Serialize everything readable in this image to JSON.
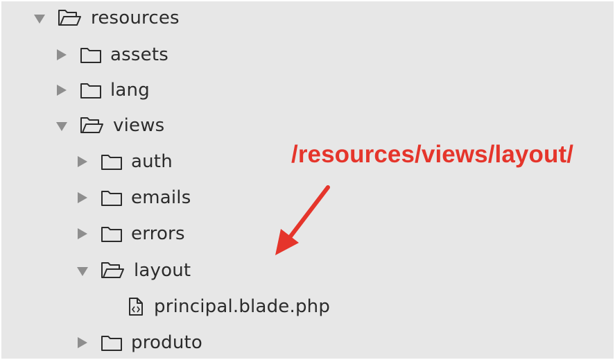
{
  "tree": {
    "items": [
      {
        "name": "resources",
        "kind": "folder",
        "expanded": true,
        "icon": "folder-open-icon"
      },
      {
        "name": "assets",
        "kind": "folder",
        "expanded": false,
        "icon": "folder-icon"
      },
      {
        "name": "lang",
        "kind": "folder",
        "expanded": false,
        "icon": "folder-icon"
      },
      {
        "name": "views",
        "kind": "folder",
        "expanded": true,
        "icon": "folder-open-icon"
      },
      {
        "name": "auth",
        "kind": "folder",
        "expanded": false,
        "icon": "folder-icon"
      },
      {
        "name": "emails",
        "kind": "folder",
        "expanded": false,
        "icon": "folder-icon"
      },
      {
        "name": "errors",
        "kind": "folder",
        "expanded": false,
        "icon": "folder-icon"
      },
      {
        "name": "layout",
        "kind": "folder",
        "expanded": true,
        "icon": "folder-open-icon"
      },
      {
        "name": "principal.blade.php",
        "kind": "file",
        "icon": "code-file-icon"
      },
      {
        "name": "produto",
        "kind": "folder",
        "expanded": false,
        "icon": "folder-icon"
      }
    ]
  },
  "annotation": {
    "text": "/resources/views/layout/",
    "color": "#e5352b"
  },
  "colors": {
    "background": "#e7e7e7",
    "text": "#2b2b2b",
    "disclosure_arrow": "#8e8e8e"
  }
}
